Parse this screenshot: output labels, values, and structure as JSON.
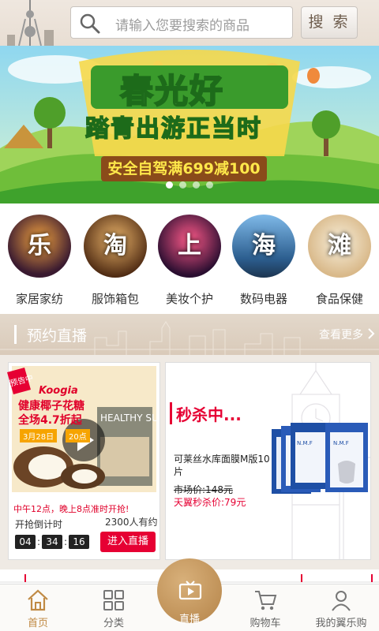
{
  "search": {
    "placeholder": "请输入您要搜索的商品",
    "button_label": "搜 索"
  },
  "banner": {
    "title": "春光好",
    "subtitle": "踏青出游正当时",
    "promo": "安全自驾满699减100",
    "slide_count": 4,
    "active_slide": 0
  },
  "categories": [
    {
      "char": "乐",
      "label": "家居家纺"
    },
    {
      "char": "淘",
      "label": "服饰箱包"
    },
    {
      "char": "上",
      "label": "美妆个护"
    },
    {
      "char": "海",
      "label": "数码电器"
    },
    {
      "char": "滩",
      "label": "食品保健"
    }
  ],
  "live_section": {
    "title": "预约直播",
    "more_label": "查看更多"
  },
  "presale_card": {
    "badge": "预告中",
    "product_brand": "Koogia",
    "product_title": "健康椰子花糖",
    "product_discount": "全场4.7折起",
    "product_date": "3月28日",
    "product_time": "20点",
    "package_text": "HEALTHY SUGAR",
    "promo_text": "中午12点，晚上8点准时开抢!",
    "countdown_label": "开抢倒计时",
    "reserved_count": "2300人有约",
    "timer": {
      "hours": "04",
      "minutes": "34",
      "seconds": "16"
    },
    "enter_button": "进入直播"
  },
  "flash_card": {
    "title": "秒杀中...",
    "product_name": "可莱丝水库面膜M版10片",
    "market_price": "市场价:148元",
    "flash_price": "天翼秒杀价:79元",
    "pack_label": "N.M.F"
  },
  "nav": {
    "items": [
      {
        "label": "首页",
        "icon": "home-icon",
        "active": true
      },
      {
        "label": "分类",
        "icon": "grid-icon",
        "active": false
      },
      {
        "label": "直播",
        "icon": "tv-icon",
        "active": false
      },
      {
        "label": "购物车",
        "icon": "cart-icon",
        "active": false
      },
      {
        "label": "我的翼乐购",
        "icon": "user-icon",
        "active": false
      }
    ]
  },
  "colors": {
    "accent": "#c08a44",
    "red": "#e60033",
    "banner_green": "#4db52e"
  }
}
